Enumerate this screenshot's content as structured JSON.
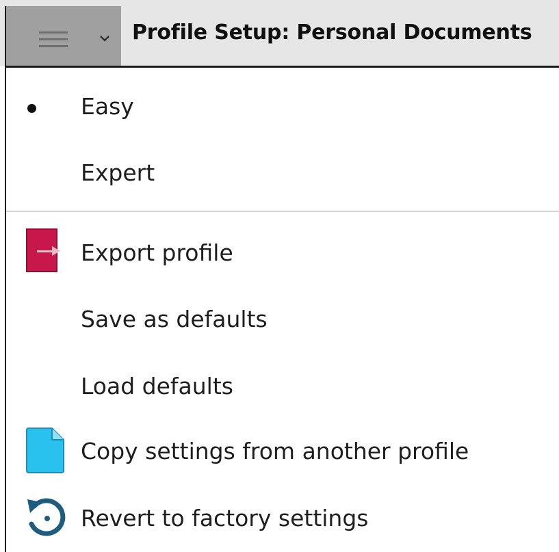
{
  "header": {
    "title": "Profile Setup: Personal Documents",
    "menu_icon": "hamburger-icon",
    "dropdown_icon": "chevron-down-icon"
  },
  "menu": {
    "mode_items": [
      {
        "label": "Easy",
        "selected": true
      },
      {
        "label": "Expert",
        "selected": false
      }
    ],
    "action_items": [
      {
        "label": "Export profile",
        "icon": "export-icon"
      },
      {
        "label": "Save as defaults",
        "icon": null
      },
      {
        "label": "Load defaults",
        "icon": null
      },
      {
        "label": "Copy settings from another profile",
        "icon": "document-icon"
      },
      {
        "label": "Revert to factory settings",
        "icon": "revert-icon"
      }
    ]
  },
  "colors": {
    "export_icon": "#c8174b",
    "document_icon": "#29c2ee",
    "revert_icon": "#1f5d7e"
  }
}
